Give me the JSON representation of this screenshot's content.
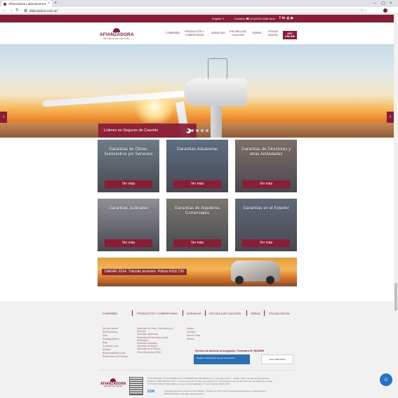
{
  "browser": {
    "tab_title": "Afianzadora Latinoamerica",
    "tab_close": "×",
    "new_tab": "+",
    "win_min": "–",
    "win_max": "▢",
    "win_close": "×",
    "back": "←",
    "forward": "→",
    "reload": "↻",
    "url": "afianzadora.com.ar/",
    "star": "☆",
    "menu": "⋮"
  },
  "topbar": {
    "language": "English  ∨",
    "contact": "Contacto  ☎ (11)4032-3488 idioo",
    "social": [
      "f",
      "in",
      "◎",
      "▶"
    ]
  },
  "header": {
    "logo_name": "AFIANZADORA",
    "logo_tagline": "SEGUROS DE CAUCIÓN",
    "nav": [
      {
        "label": "COMPAÑÍA"
      },
      {
        "label": "PRODUCTOS Y COBERTURAS"
      },
      {
        "label": "AGENCIAS"
      },
      {
        "label": "ESCUELA DE CAUCIÓN"
      },
      {
        "label": "OBRAS"
      },
      {
        "label": "PÓLIZA DIGITAL"
      }
    ],
    "art_button": "ART ONLINE"
  },
  "hero": {
    "caption": "Líderes en Seguros de Caución",
    "caption_arrow": "›",
    "prev_arrow": "‹",
    "next_arrow": "›",
    "slides_total": 5,
    "active_slide": 1
  },
  "cards": [
    {
      "title": "Garantías de Obras, Suministros y/o Servicios",
      "button": "Ver más",
      "color": "#6f7d86"
    },
    {
      "title": "Garantías Aduaneras",
      "button": "Ver más",
      "color": "#5d6f84"
    },
    {
      "title": "Garantías de Directores y otras Actividades",
      "button": "Ver más",
      "color": "#7d6f66"
    },
    {
      "title": "Garantías Judiciales",
      "button": "Ver más",
      "color": "#8f9097"
    },
    {
      "title": "Garantías de Alquileres Comerciales",
      "button": "Ver más",
      "color": "#7b786e"
    },
    {
      "title": "Garantías en el Exterior",
      "button": "Ver más",
      "color": "#5f6a78"
    }
  ],
  "banner": {
    "text": "DAKAR 2014. Tránsito terrestre. Póliza #318.730"
  },
  "footer": {
    "nav": [
      "COMPAÑÍA",
      "PRODUCTOS Y COBERTURAS",
      "AGENCIAS",
      "ESCUELA DE CAUCIÓN",
      "OBRAS",
      "PÓLIZA DIGITAL"
    ],
    "col1": [
      "Quiénes somos",
      "Staff Ejecutivos",
      "Staff",
      "Reaseguradores",
      "Blog",
      "Contactos y eco",
      "Noticias",
      "Responsabilidad social",
      "Reservatoria de Proceder"
    ],
    "col2": [
      "Garantías de Obras, Suministros y/o Servicios",
      "Garantías Aduaneras",
      "Garantías de Directores y otras Actividades",
      "Garantías Judiciales",
      "Garantías de Alquiler",
      "Garantías en el Exterior",
      "Póliza Electrónica (PAE)"
    ],
    "col3": [
      "Abasta",
      "Contacto",
      "Mar del Plata",
      "Rosario"
    ],
    "service": "Servicio de Atención al Asegurado. Formulario Nº 9812/999",
    "badge_left": "Registro Nacional de Seguro de Caución",
    "badge_right": "DNV CERTIFIED",
    "logo_name": "AFIANZADORA",
    "logo_tagline": "SEGUROS DE CAUCIÓN",
    "legal1": "AFIANZADORA LATINOAMERICANA COMPAÑÍA DE SEGUROS S.A. | Tucumán 811 P.2 - Código 1049 | Ciudad de Buenos Aires",
    "legal2": "Teléfono: 4488-2600 Asimismo y preferentemente Consejo de Seguros S.A. se identifica en la Ley de Protección de Datos Personales",
    "legal3": "Nº 25.326, SSN Nº 0001-0004 y demás normas aplicables. Nº de inscripción SSN: 0476",
    "ssn_logo": "SSN",
    "legal4": "Superintendencia de Seguros de la Nación - Órgano de Control de la actividad aseguradora y reaseguradora",
    "legal5": "0800-666-8400 | www.argentina.gob.ar/ssn",
    "chat_icon": "☺"
  }
}
